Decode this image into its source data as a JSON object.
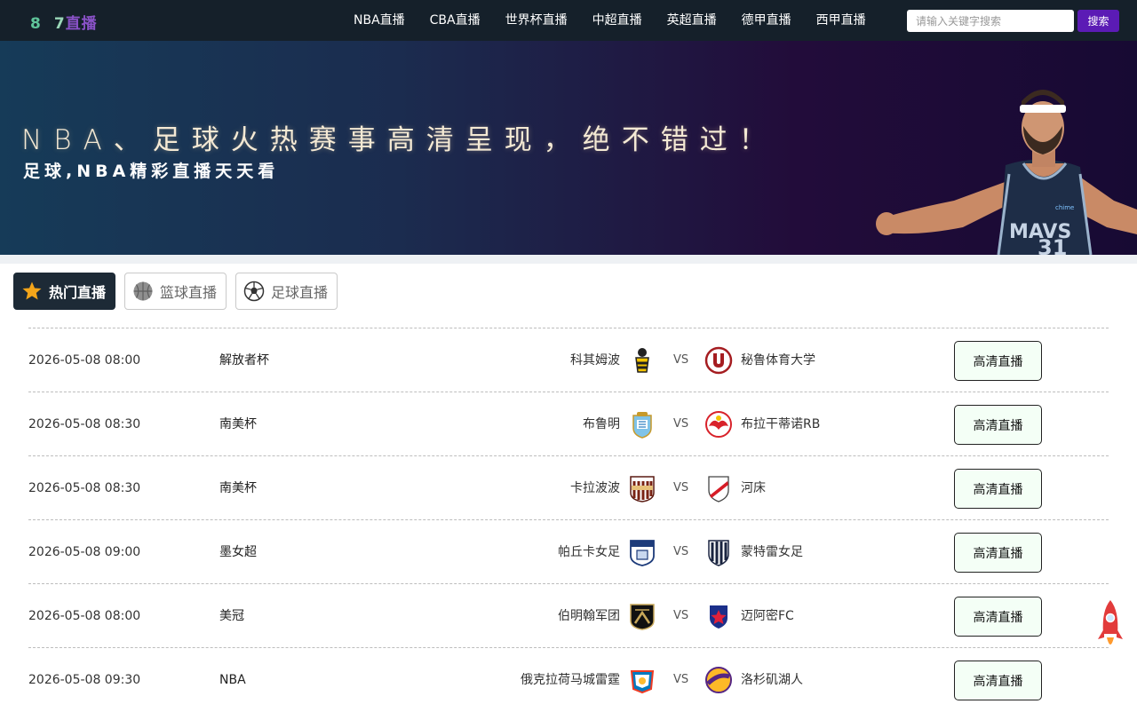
{
  "header": {
    "logo_digit1": "8",
    "logo_digit2": "7",
    "logo_text": "直播",
    "nav": [
      "NBA直播",
      "CBA直播",
      "世界杯直播",
      "中超直播",
      "英超直播",
      "德甲直播",
      "西甲直播"
    ],
    "search_placeholder": "请输入关键字搜索",
    "search_button": "搜索"
  },
  "banner": {
    "title": "NBA、足球火热赛事高清呈现，绝不错过！",
    "subtitle": "足球,NBA精彩直播天天看",
    "jersey_text": "MAVS",
    "jersey_number": "31",
    "jersey_sponsor": "chime"
  },
  "tabs": [
    {
      "label": "热门直播",
      "icon": "star-icon"
    },
    {
      "label": "篮球直播",
      "icon": "basketball-icon"
    },
    {
      "label": "足球直播",
      "icon": "soccer-ball-icon"
    }
  ],
  "matches": [
    {
      "time": "2026-05-08 08:00",
      "league": "解放者杯",
      "home": "科其姆波",
      "vs": "VS",
      "away": "秘鲁体育大学",
      "button": "高清直播"
    },
    {
      "time": "2026-05-08 08:30",
      "league": "南美杯",
      "home": "布鲁明",
      "vs": "VS",
      "away": "布拉干蒂诺RB",
      "button": "高清直播"
    },
    {
      "time": "2026-05-08 08:30",
      "league": "南美杯",
      "home": "卡拉波波",
      "vs": "VS",
      "away": "河床",
      "button": "高清直播"
    },
    {
      "time": "2026-05-08 09:00",
      "league": "墨女超",
      "home": "帕丘卡女足",
      "vs": "VS",
      "away": "蒙特雷女足",
      "button": "高清直播"
    },
    {
      "time": "2026-05-08 08:00",
      "league": "美冠",
      "home": "伯明翰军团",
      "vs": "VS",
      "away": "迈阿密FC",
      "button": "高清直播"
    },
    {
      "time": "2026-05-08 09:30",
      "league": "NBA",
      "home": "俄克拉荷马城雷霆",
      "vs": "VS",
      "away": "洛杉矶湖人",
      "button": "高清直播"
    }
  ],
  "colors": {
    "header_bg": "#15202a",
    "search_button": "#5b1bb5",
    "active_tab": "#1d2a36",
    "watch_button_bg": "#f4fff6"
  }
}
